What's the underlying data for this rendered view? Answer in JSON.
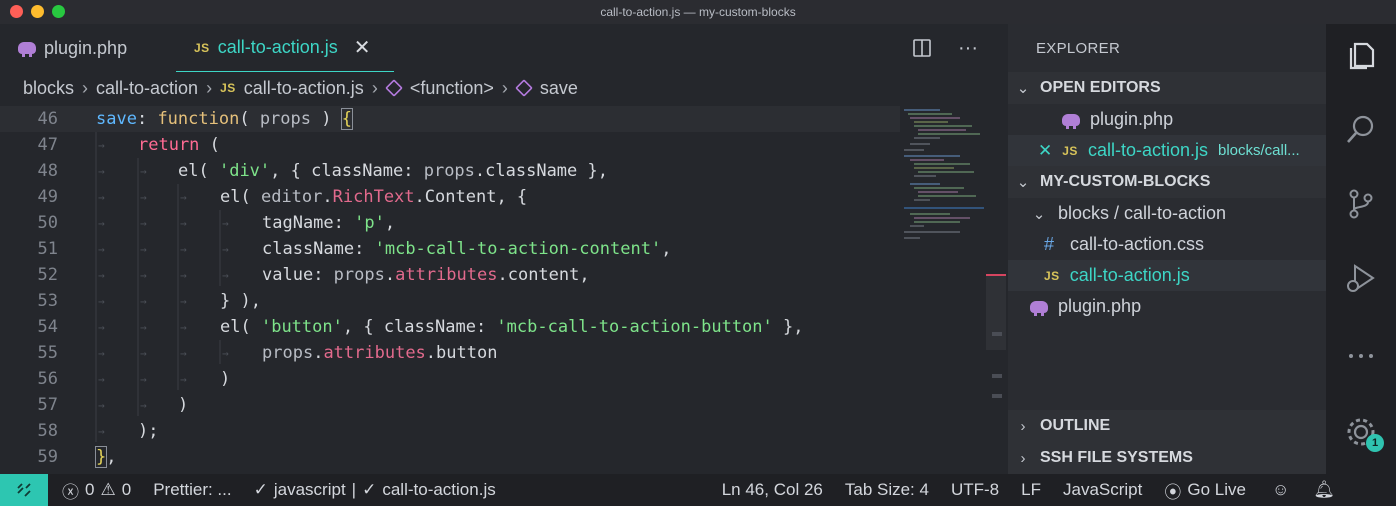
{
  "window": {
    "title": "call-to-action.js — my-custom-blocks"
  },
  "tabs": [
    {
      "label": "plugin.php",
      "icon": "php-elephant-icon",
      "active": false
    },
    {
      "label": "call-to-action.js",
      "icon": "js-icon",
      "icon_text": "JS",
      "active": true
    }
  ],
  "breadcrumb": {
    "parts": [
      "blocks",
      "call-to-action",
      "call-to-action.js",
      "<function>",
      "save"
    ]
  },
  "code": {
    "lines": [
      {
        "n": "46"
      },
      {
        "n": "47"
      },
      {
        "n": "48"
      },
      {
        "n": "49"
      },
      {
        "n": "50"
      },
      {
        "n": "51"
      },
      {
        "n": "52"
      },
      {
        "n": "53"
      },
      {
        "n": "54"
      },
      {
        "n": "55"
      },
      {
        "n": "56"
      },
      {
        "n": "57"
      },
      {
        "n": "58"
      },
      {
        "n": "59"
      }
    ],
    "tokens": {
      "save": "save",
      "function": "function",
      "props": "props",
      "return": "return",
      "el": "el",
      "div": "'div'",
      "className": "className",
      "editor": "editor",
      "RichText": "RichText",
      "Content": "Content",
      "tagName": "tagName",
      "p": "'p'",
      "content_class": "'mcb-call-to-action-content'",
      "value": "value",
      "attributes": "attributes",
      "content": "content",
      "button_str": "'button'",
      "button_class": "'mcb-call-to-action-button'",
      "button": "button"
    }
  },
  "explorer": {
    "title": "EXPLORER",
    "open_editors": {
      "label": "OPEN EDITORS",
      "items": [
        {
          "label": "plugin.php",
          "hint": ""
        },
        {
          "label": "call-to-action.js",
          "hint": "blocks/call..."
        }
      ]
    },
    "project": {
      "label": "MY-CUSTOM-BLOCKS",
      "folder": "blocks / call-to-action",
      "files": [
        "call-to-action.css",
        "call-to-action.js",
        "plugin.php"
      ]
    },
    "outline": "OUTLINE",
    "ssh": "SSH FILE SYSTEMS"
  },
  "activity": {
    "settings_badge": "1"
  },
  "status": {
    "errors": "0",
    "warnings": "0",
    "prettier": "Prettier: ...",
    "lint": "javascript",
    "file_check": "call-to-action.js",
    "position": "Ln 46, Col 26",
    "tab_size": "Tab Size: 4",
    "encoding": "UTF-8",
    "eol": "LF",
    "language": "JavaScript",
    "go_live": "Go Live"
  }
}
